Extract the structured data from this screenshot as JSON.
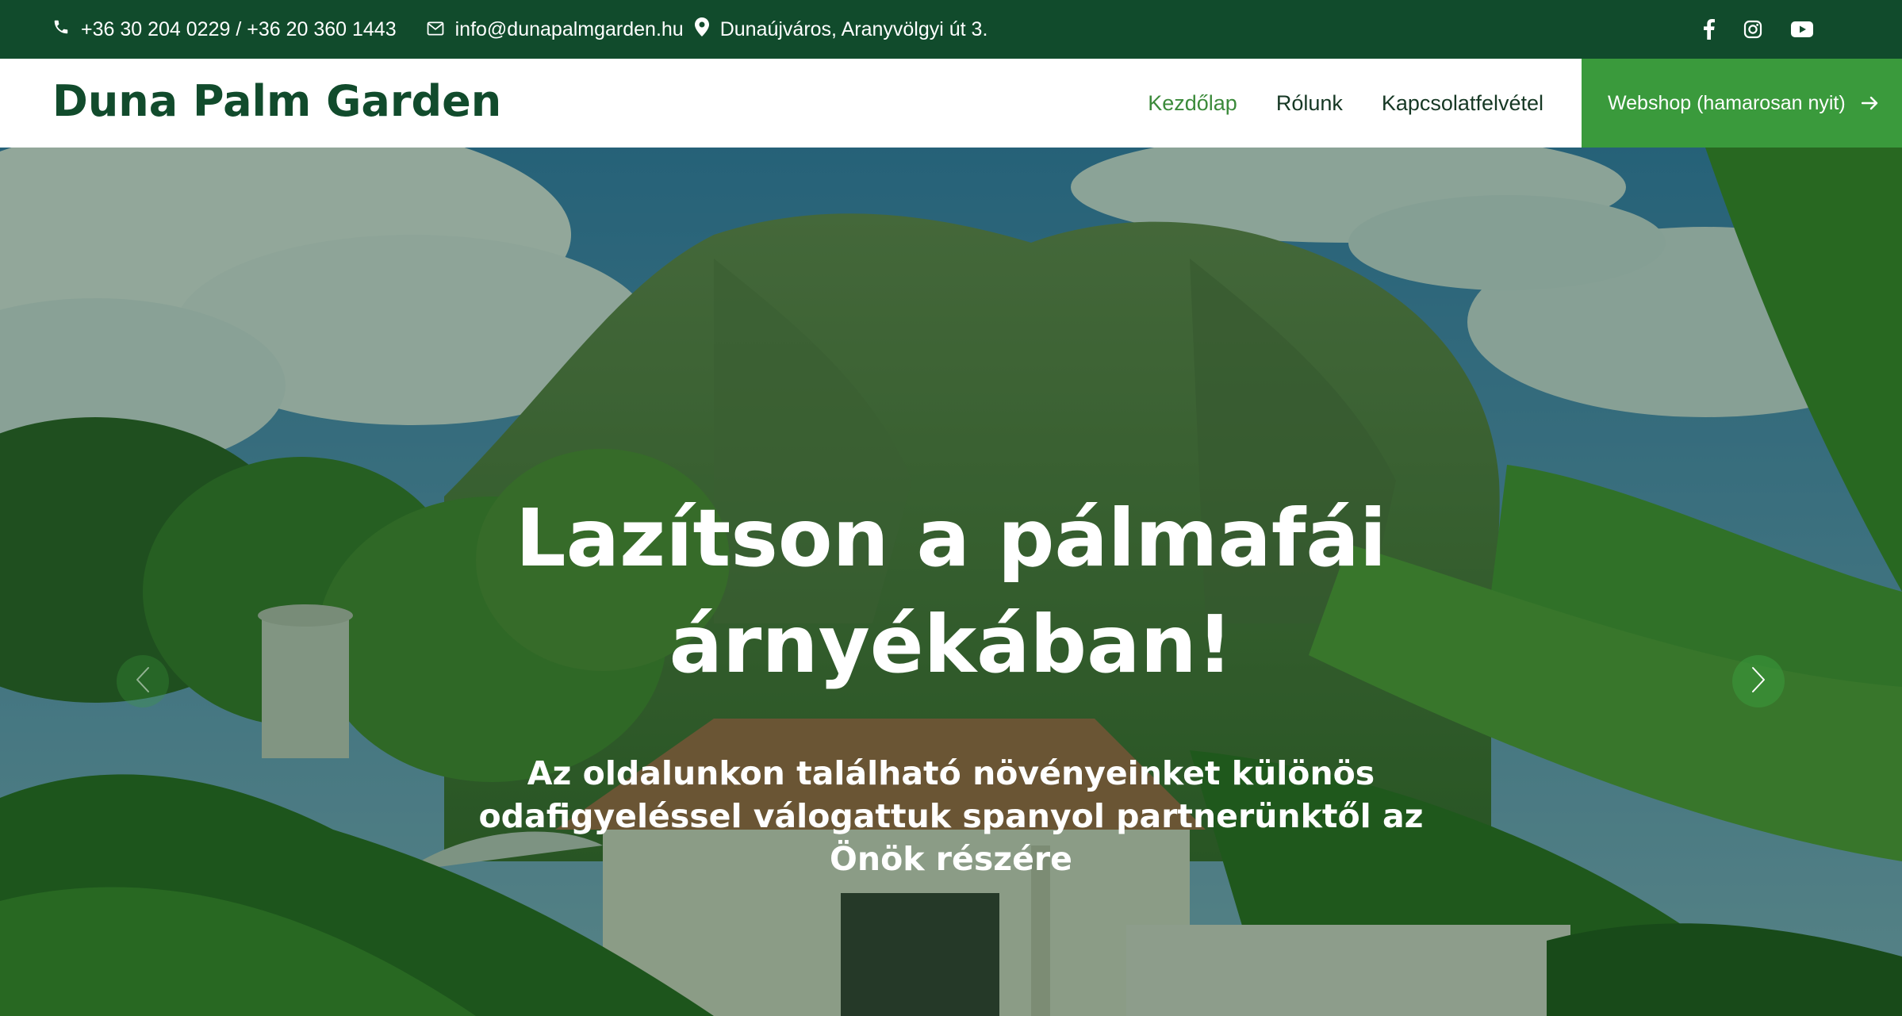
{
  "topbar": {
    "phone": "+36 30 204 0229 / +36 20 360 1443",
    "email": "info@dunapalmgarden.hu",
    "address": "Dunaújváros, Aranyvölgyi út 3.",
    "social": [
      {
        "name": "facebook-icon"
      },
      {
        "name": "instagram-icon"
      },
      {
        "name": "youtube-icon"
      }
    ]
  },
  "header": {
    "logo": "Duna Palm Garden",
    "nav": {
      "home": "Kezdőlap",
      "about": "Rólunk",
      "contact": "Kapcsolatfelvétel"
    },
    "webshop": "Webshop (hamarosan nyit)"
  },
  "hero": {
    "title_line1": "Lazítson a pálmafái",
    "title_line2": "árnyékában!",
    "subtitle": "Az oldalunkon található növényeinket különös odafigyeléssel válogattuk spanyol partnerünktől az Önök részére"
  },
  "colors": {
    "topbar_bg": "#114b2c",
    "brand_dark": "#114b2c",
    "accent_green": "#3a9a3c",
    "nav_active": "#3b8a3a"
  }
}
